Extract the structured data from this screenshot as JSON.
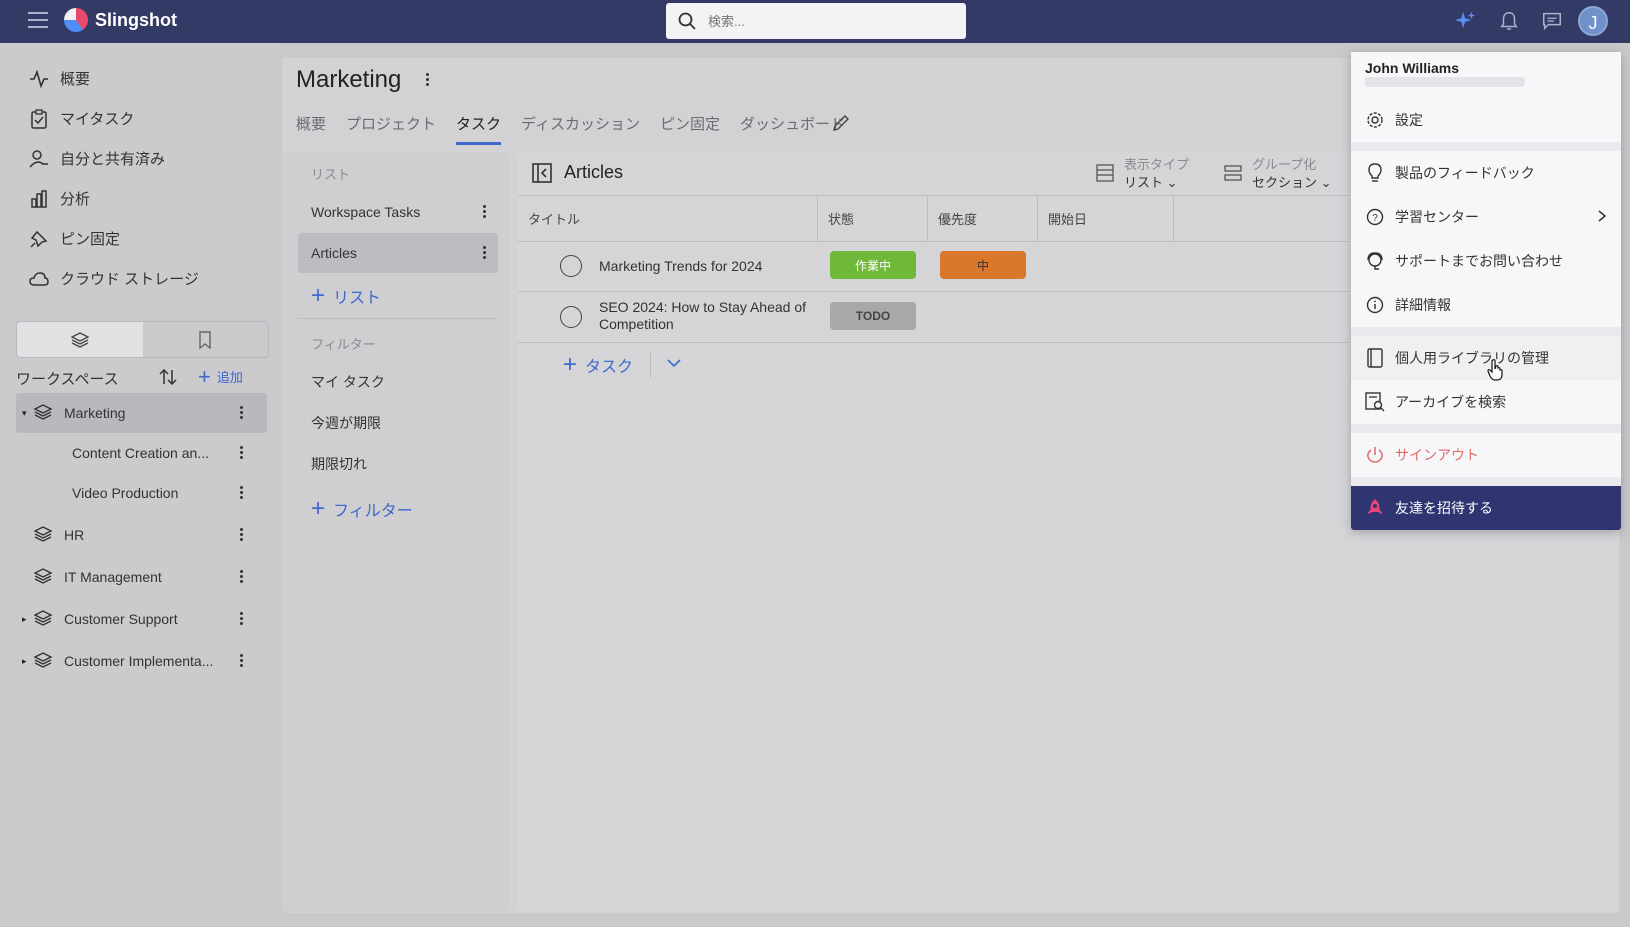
{
  "app": {
    "name": "Slingshot"
  },
  "search": {
    "placeholder": "検索..."
  },
  "user": {
    "initial": "J",
    "name": "John Williams"
  },
  "colors": {
    "topbar": "#343a66",
    "accent": "#3f67cc",
    "status_in_progress": "#6fb83a",
    "status_todo": "#a8a8ab",
    "priority_medium": "#d9772b",
    "invite_bg": "#2f3570",
    "signout": "#e06a6a"
  },
  "sidebar": {
    "nav": [
      {
        "label": "概要",
        "icon": "activity-icon"
      },
      {
        "label": "マイタスク",
        "icon": "clipboard-icon"
      },
      {
        "label": "自分と共有済み",
        "icon": "user-share-icon"
      },
      {
        "label": "分析",
        "icon": "bar-chart-icon"
      },
      {
        "label": "ピン固定",
        "icon": "pin-icon"
      },
      {
        "label": "クラウド ストレージ",
        "icon": "cloud-icon"
      }
    ],
    "workspace_title": "ワークスペース",
    "add_label": "追加",
    "workspaces": [
      {
        "label": "Marketing",
        "expanded": true,
        "active": true
      },
      {
        "label": "Content Creation an...",
        "child": true
      },
      {
        "label": "Video Production",
        "child": true
      },
      {
        "label": "HR"
      },
      {
        "label": "IT Management"
      },
      {
        "label": "Customer Support",
        "collapsed": true
      },
      {
        "label": "Customer Implementa...",
        "collapsed": true
      }
    ]
  },
  "page": {
    "title": "Marketing",
    "tabs": [
      "概要",
      "プロジェクト",
      "タスク",
      "ディスカッション",
      "ピン固定",
      "ダッシュボード"
    ],
    "active_tab": "タスク"
  },
  "lists_panel": {
    "lists_label": "リスト",
    "lists": [
      "Workspace Tasks",
      "Articles"
    ],
    "active_list": "Articles",
    "add_list": "リスト",
    "filters_label": "フィルター",
    "filters": [
      "マイ タスク",
      "今週が期限",
      "期限切れ"
    ],
    "add_filter": "フィルター"
  },
  "table": {
    "title": "Articles",
    "view_type_label": "表示タイプ",
    "view_type_value": "リスト",
    "group_label": "グループ化",
    "group_value": "セクション",
    "columns": [
      "タイトル",
      "状態",
      "優先度",
      "開始日"
    ],
    "rows": [
      {
        "title": "Marketing Trends for 2024",
        "status": "作業中",
        "priority": "中"
      },
      {
        "title_line1": "SEO 2024: How to Stay Ahead of",
        "title_line2": "Competition",
        "status": "TODO"
      }
    ],
    "add_task": "タスク"
  },
  "menu": {
    "settings": "設定",
    "feedback": "製品のフィードバック",
    "learning": "学習センター",
    "support": "サポートまでお問い合わせ",
    "info": "詳細情報",
    "library": "個人用ライブラリの管理",
    "archive": "アーカイブを検索",
    "signout": "サインアウト",
    "invite": "友達を招待する"
  }
}
